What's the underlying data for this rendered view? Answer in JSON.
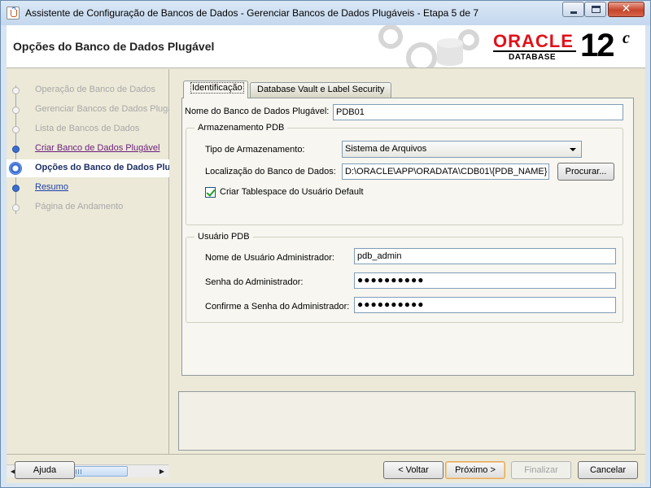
{
  "window": {
    "title": "Assistente de Configuração de Bancos de Dados - Gerenciar Bancos de Dados Plugáveis - Etapa 5 de 7",
    "close_glyph": "✕"
  },
  "header": {
    "title": "Opções do Banco de Dados Plugável",
    "logo_oracle": "ORACLE",
    "logo_database": "DATABASE",
    "logo_version": "12",
    "logo_version_suffix": "c"
  },
  "steps": [
    {
      "label": "Operação de Banco de Dados",
      "state": "disabled"
    },
    {
      "label": "Gerenciar Bancos de Dados Plugá",
      "state": "disabled"
    },
    {
      "label": "Lista de Bancos de Dados",
      "state": "disabled"
    },
    {
      "label": "Criar Banco de Dados Plugável",
      "state": "visited"
    },
    {
      "label": "Opções do Banco de Dados Plu",
      "state": "current"
    },
    {
      "label": "Resumo",
      "state": "link"
    },
    {
      "label": "Página de Andamento",
      "state": "disabled"
    }
  ],
  "tabs": [
    {
      "label": "Identificação",
      "active": true
    },
    {
      "label": "Database Vault e Label Security",
      "active": false
    }
  ],
  "form": {
    "pdb_name_label": "Nome do Banco de Dados Plugável:",
    "pdb_name_value": "PDB01",
    "storage_group_title": "Armazenamento PDB",
    "storage_type_label": "Tipo de Armazenamento:",
    "storage_type_value": "Sistema de Arquivos",
    "location_label": "Localização do Banco de Dados:",
    "location_value": "D:\\ORACLE\\APP\\ORADATA\\CDB01\\{PDB_NAME}",
    "browse_label": "Procurar...",
    "tablespace_checkbox_label": "Criar Tablespace do Usuário Default",
    "tablespace_checked": true,
    "user_group_title": "Usuário PDB",
    "admin_user_label": "Nome de Usuário Administrador:",
    "admin_user_value": "pdb_admin",
    "admin_password_label": "Senha do Administrador:",
    "admin_password_value": "●●●●●●●●●●",
    "confirm_password_label": "Confirme a Senha do Administrador:",
    "confirm_password_value": "●●●●●●●●●●"
  },
  "footer": {
    "help": "Ajuda",
    "back": "< Voltar",
    "next": "Próximo >",
    "finish": "Finalizar",
    "cancel": "Cancelar"
  },
  "colors": {
    "oracle_red": "#e0121a",
    "current_step": "#1d2f63",
    "link_visited": "#6a1f7a",
    "link": "#1f3fa8"
  }
}
